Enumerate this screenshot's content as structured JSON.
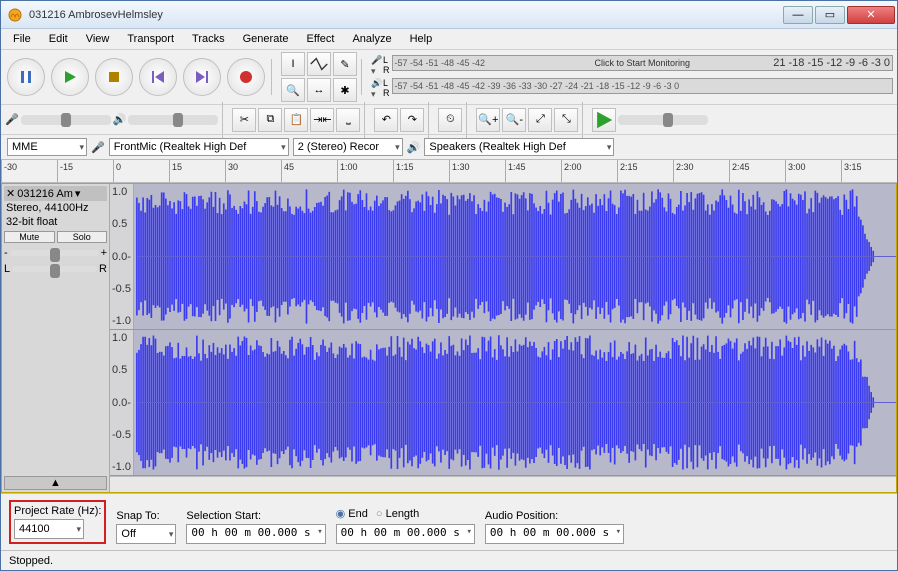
{
  "window": {
    "title": "031216 AmbrosevHelmsley"
  },
  "menu": [
    "File",
    "Edit",
    "View",
    "Transport",
    "Tracks",
    "Generate",
    "Effect",
    "Analyze",
    "Help"
  ],
  "meter": {
    "rec_nums": "-57 -54 -51 -48 -45 -42",
    "rec_overlay": "Click to Start Monitoring",
    "rec_tail": "21 -18 -15 -12  -9  -6  -3  0",
    "play_nums": "-57 -54 -51 -48 -45 -42 -39 -36 -33 -30 -27 -24 -21 -18 -15 -12  -9  -6  -3  0"
  },
  "devices": {
    "host": "MME",
    "input": "FrontMic (Realtek High Def",
    "channels": "2 (Stereo) Recor",
    "output": "Speakers (Realtek High Def"
  },
  "timeline": [
    "-30",
    "-15",
    "0",
    "15",
    "30",
    "45",
    "1:00",
    "1:15",
    "1:30",
    "1:45",
    "2:00",
    "2:15",
    "2:30",
    "2:45",
    "3:00",
    "3:15"
  ],
  "track": {
    "name": "031216 Am",
    "format": "Stereo, 44100Hz",
    "depth": "32-bit float",
    "mute": "Mute",
    "solo": "Solo",
    "gain_left": "-",
    "gain_right": "+",
    "pan_left": "L",
    "pan_right": "R",
    "yaxis": [
      "1.0",
      "0.5",
      "0.0-",
      "-0.5",
      "-1.0"
    ]
  },
  "selection": {
    "rate_label": "Project Rate (Hz):",
    "rate": "44100",
    "snap_label": "Snap To:",
    "snap": "Off",
    "start_label": "Selection Start:",
    "start": "00 h 00 m 00.000 s",
    "end_label": "End",
    "length_label": "Length",
    "end": "00 h 00 m 00.000 s",
    "pos_label": "Audio Position:",
    "pos": "00 h 00 m 00.000 s"
  },
  "status": "Stopped."
}
